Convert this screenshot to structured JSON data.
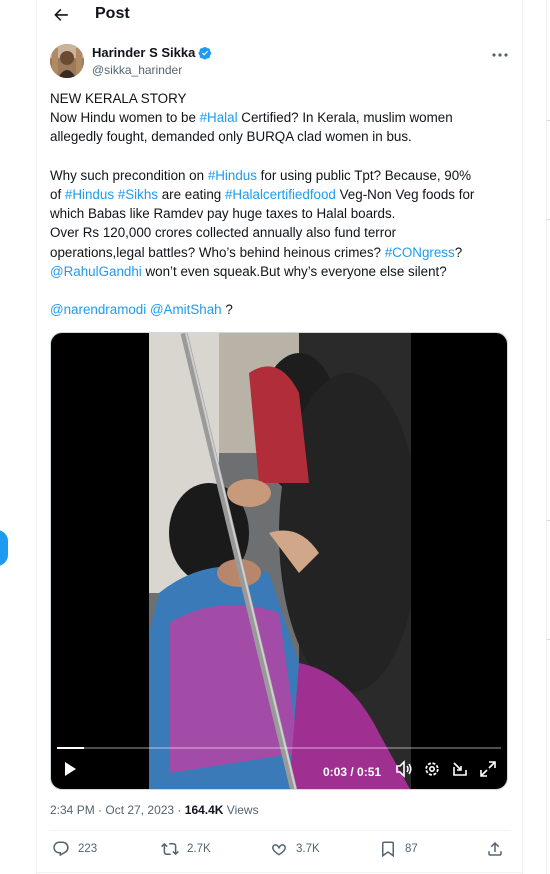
{
  "header": {
    "title": "Post",
    "back_icon": "arrow-left-icon"
  },
  "author": {
    "name": "Harinder S Sikka",
    "handle": "@sikka_harinder",
    "verified_icon": "verified-badge-icon",
    "more_icon": "more-horizontal-icon"
  },
  "tweet": {
    "lines": [
      [
        {
          "t": "NEW KERALA STORY"
        }
      ],
      [
        {
          "t": "Now Hindu women to be "
        },
        {
          "t": "#Halal",
          "tag": true
        },
        {
          "t": " Certified? In Kerala, muslim women"
        }
      ],
      [
        {
          "t": "allegedly fought, demanded only BURQA clad women in bus."
        }
      ],
      [],
      [
        {
          "t": "Why such precondition on "
        },
        {
          "t": "#Hindus",
          "tag": true
        },
        {
          "t": " for using public Tpt? Because, 90%"
        }
      ],
      [
        {
          "t": "of "
        },
        {
          "t": "#Hindus",
          "tag": true
        },
        {
          "t": " "
        },
        {
          "t": "#Sikhs",
          "tag": true
        },
        {
          "t": " are eating "
        },
        {
          "t": "#Halalcertifiedfood",
          "tag": true
        },
        {
          "t": " Veg-Non Veg foods for"
        }
      ],
      [
        {
          "t": "which Babas like Ramdev pay huge taxes to Halal boards."
        }
      ],
      [
        {
          "t": "Over Rs 120,000 crores collected annually also fund terror"
        }
      ],
      [
        {
          "t": "operations,legal battles? Who’s behind heinous crimes? "
        },
        {
          "t": "#CONgress",
          "tag": true
        },
        {
          "t": "?"
        }
      ],
      [
        {
          "t": "@RahulGandhi",
          "tag": true
        },
        {
          "t": " won’t even squeak.But why’s everyone else silent?"
        }
      ],
      [],
      [
        {
          "t": "@narendramodi",
          "tag": true
        },
        {
          "t": " "
        },
        {
          "t": "@AmitShah",
          "tag": true
        },
        {
          "t": " ?"
        }
      ]
    ]
  },
  "video": {
    "current_time": "0:03",
    "duration": "0:51",
    "time_display": "0:03 / 0:51",
    "progress": 0.06,
    "controls": [
      "play-icon",
      "volume-icon",
      "settings-icon",
      "dock-icon",
      "fullscreen-icon"
    ]
  },
  "meta": {
    "time": "2:34 PM",
    "separator": " · ",
    "date": "Oct 27, 2023",
    "views_count": "164.4K",
    "views_label": " Views"
  },
  "actions": {
    "replies": "223",
    "reposts": "2.7K",
    "likes": "3.7K",
    "bookmarks": "87"
  },
  "colors": {
    "accent": "#1d9bf0",
    "text": "#0f1419",
    "muted": "#536471",
    "border": "#eff3f4"
  }
}
